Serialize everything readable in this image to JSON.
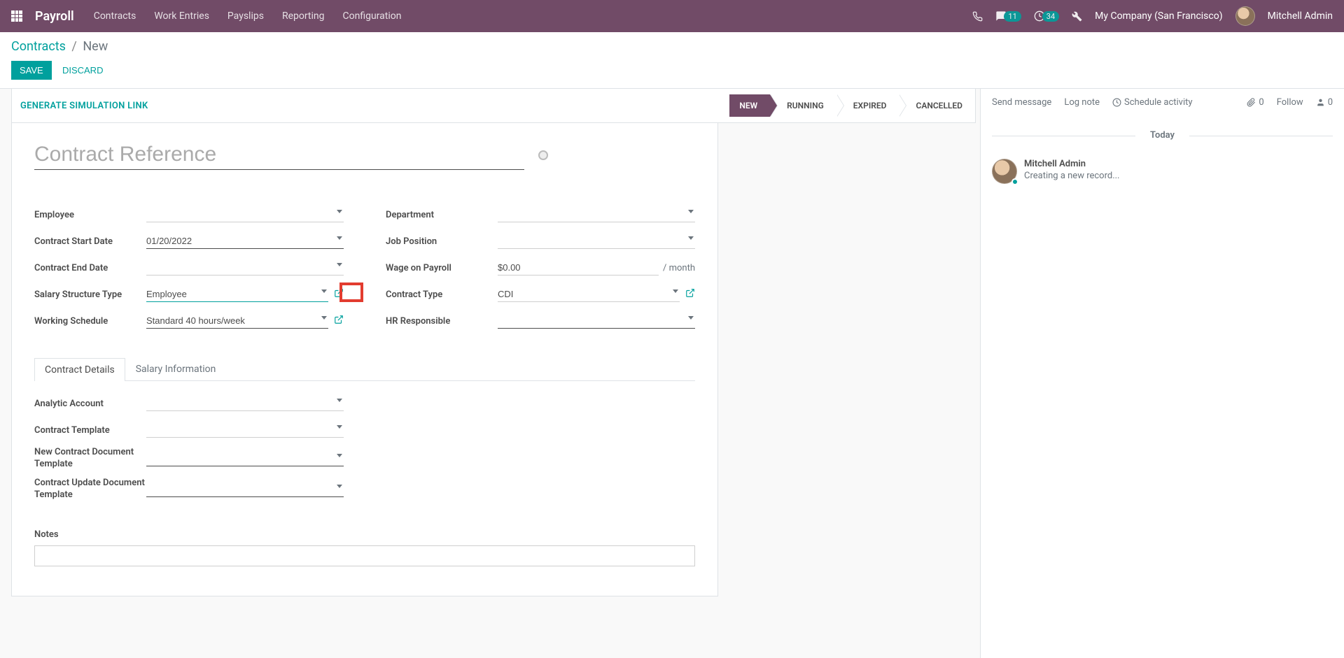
{
  "navbar": {
    "brand": "Payroll",
    "menu": [
      "Contracts",
      "Work Entries",
      "Payslips",
      "Reporting",
      "Configuration"
    ],
    "msg_badge": "11",
    "activity_badge": "34",
    "company": "My Company (San Francisco)",
    "user": "Mitchell Admin"
  },
  "breadcrumb": {
    "root": "Contracts",
    "current": "New"
  },
  "buttons": {
    "save": "Save",
    "discard": "Discard"
  },
  "statusbar": {
    "gen_link": "Generate Simulation Link",
    "stages": [
      "New",
      "Running",
      "Expired",
      "Cancelled"
    ],
    "active_index": 0
  },
  "form": {
    "title_placeholder": "Contract Reference",
    "left": {
      "employee": {
        "label": "Employee",
        "value": ""
      },
      "start": {
        "label": "Contract Start Date",
        "value": "01/20/2022"
      },
      "end": {
        "label": "Contract End Date",
        "value": ""
      },
      "struct": {
        "label": "Salary Structure Type",
        "value": "Employee"
      },
      "sched": {
        "label": "Working Schedule",
        "value": "Standard 40 hours/week"
      }
    },
    "right": {
      "dept": {
        "label": "Department",
        "value": ""
      },
      "job": {
        "label": "Job Position",
        "value": ""
      },
      "wage": {
        "label": "Wage on Payroll",
        "value": "$0.00",
        "suffix": "/ month"
      },
      "ctype": {
        "label": "Contract Type",
        "value": "CDI"
      },
      "hr": {
        "label": "HR Responsible",
        "value": ""
      }
    },
    "tabs": [
      "Contract Details",
      "Salary Information"
    ],
    "details": {
      "analytic": {
        "label": "Analytic Account",
        "value": ""
      },
      "template": {
        "label": "Contract Template",
        "value": ""
      },
      "newdoc": {
        "label": "New Contract Document Template",
        "value": ""
      },
      "upddoc": {
        "label": "Contract Update Document Template",
        "value": ""
      },
      "notes_label": "Notes"
    }
  },
  "chatter": {
    "send": "Send message",
    "log": "Log note",
    "schedule": "Schedule activity",
    "attach_count": "0",
    "follow": "Follow",
    "follower_count": "0",
    "day": "Today",
    "msg_author": "Mitchell Admin",
    "msg_body": "Creating a new record..."
  }
}
